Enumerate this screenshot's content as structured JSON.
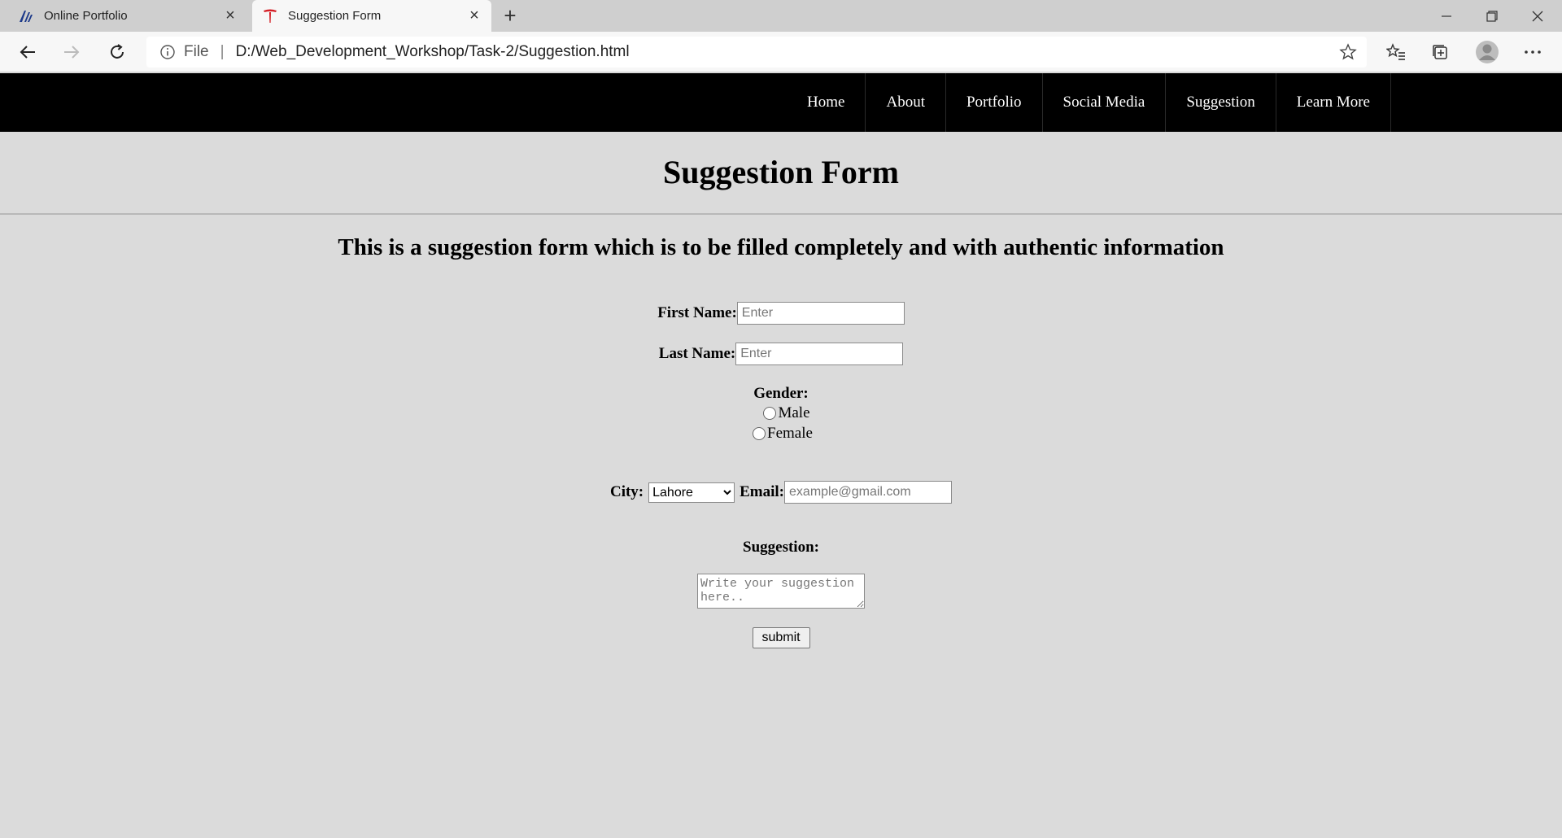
{
  "browser": {
    "tabs": [
      {
        "title": "Online Portfolio",
        "active": false
      },
      {
        "title": "Suggestion Form",
        "active": true
      }
    ],
    "address": {
      "scheme_label": "File",
      "url": "D:/Web_Development_Workshop/Task-2/Suggestion.html"
    },
    "icons": [
      "back-icon",
      "forward-icon",
      "refresh-icon",
      "info-icon",
      "star-icon",
      "favorites-icon",
      "collections-icon",
      "profile-icon",
      "more-icon"
    ]
  },
  "nav": {
    "items": [
      "Home",
      "About",
      "Portfolio",
      "Social Media",
      "Suggestion",
      "Learn More"
    ]
  },
  "page": {
    "title": "Suggestion Form",
    "subtitle": "This is a suggestion form which is to be filled completely and with authentic information"
  },
  "form": {
    "first_name_label": "First Name:",
    "first_name_placeholder": "Enter",
    "last_name_label": "Last Name:",
    "last_name_placeholder": "Enter",
    "gender_label": "Gender:",
    "gender_options": [
      "Male",
      "Female"
    ],
    "city_label": "City:",
    "city_selected": "Lahore",
    "email_label": "Email:",
    "email_placeholder": "example@gmail.com",
    "suggestion_label": "Suggestion:",
    "suggestion_placeholder": "Write your suggestion here..",
    "submit_label": "submit"
  },
  "colors": {
    "navbar_bg": "#000000",
    "page_bg": "#dbdbdb",
    "nav_text": "#ffffff"
  }
}
